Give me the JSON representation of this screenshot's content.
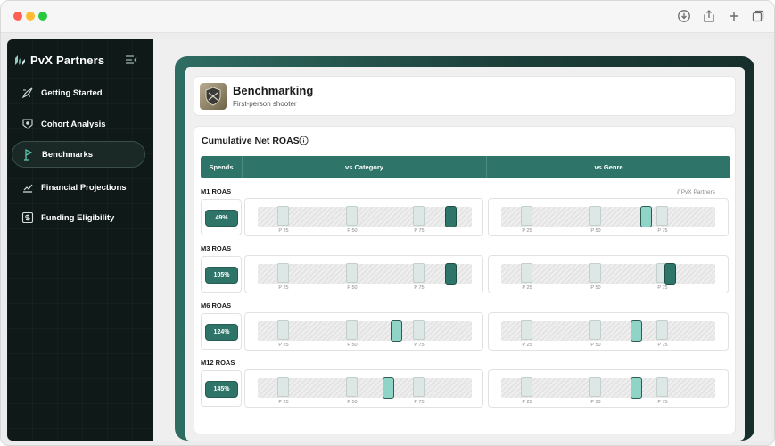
{
  "browser": {
    "icons": [
      "download-icon",
      "share-icon",
      "new-tab-icon",
      "tabs-icon"
    ]
  },
  "sidebar": {
    "brand": "PvX Partners",
    "items": [
      {
        "label": "Getting Started",
        "icon": "rocket-icon",
        "active": false
      },
      {
        "label": "Cohort Analysis",
        "icon": "cohort-icon",
        "active": false
      },
      {
        "label": "Benchmarks",
        "icon": "flag-icon",
        "active": true
      },
      {
        "label": "Financial Projections",
        "icon": "chart-icon",
        "active": false
      },
      {
        "label": "Funding Eligibility",
        "icon": "dollar-icon",
        "active": false
      }
    ]
  },
  "header": {
    "title": "Benchmarking",
    "subtitle": "First-person shooter"
  },
  "section": {
    "title": "Cumulative Net ROAS",
    "columns": [
      "Spends",
      "vs Category",
      "vs Genre"
    ],
    "watermark": "PvX Partners",
    "percentile_labels": [
      "P 25",
      "P 50",
      "P 75"
    ],
    "rows": [
      {
        "label": "M1 ROAS",
        "spend": "49%",
        "category_position": 0.93,
        "category_style": "dark",
        "genre_position": 0.69,
        "genre_style": "light"
      },
      {
        "label": "M3 ROAS",
        "spend": "105%",
        "category_position": 0.93,
        "category_style": "dark",
        "genre_position": 0.81,
        "genre_style": "dark"
      },
      {
        "label": "M6 ROAS",
        "spend": "124%",
        "category_position": 0.66,
        "category_style": "light",
        "genre_position": 0.64,
        "genre_style": "light"
      },
      {
        "label": "M12 ROAS",
        "spend": "145%",
        "category_position": 0.62,
        "category_style": "light",
        "genre_position": 0.64,
        "genre_style": "light"
      }
    ]
  },
  "colors": {
    "brand_teal": "#2e7468",
    "marker_light": "#8fd4c7",
    "sidebar_bg": "#0f1a18"
  }
}
